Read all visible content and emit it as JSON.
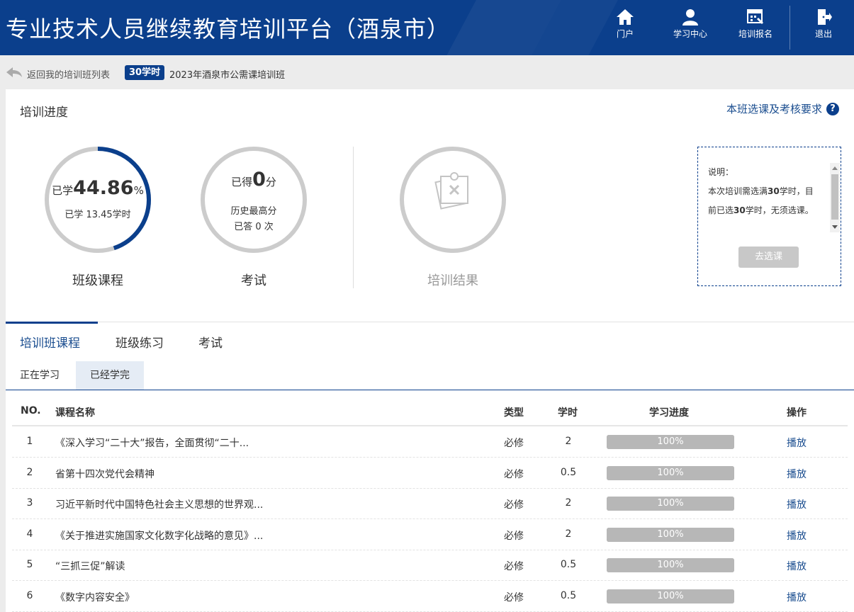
{
  "header": {
    "title": "专业技术人员继续教育培训平台（酒泉市）",
    "nav": [
      {
        "label": "门户",
        "icon": "home-icon"
      },
      {
        "label": "学习中心",
        "icon": "user-icon"
      },
      {
        "label": "培训报名",
        "icon": "register-icon"
      },
      {
        "label": "退出",
        "icon": "logout-icon"
      }
    ]
  },
  "breadcrumb": {
    "back_label": "返回我的培训班列表",
    "hours_badge": "30学时",
    "class_name": "2023年酒泉市公需课培训班"
  },
  "progress": {
    "title": "培训进度",
    "requirements_link": "本班选课及考核要求",
    "help_glyph": "?",
    "course": {
      "prefix": "已学",
      "percent": "44.86",
      "percent_sign": "%",
      "percent_value": 44.86,
      "hours_text": "已学 13.45学时",
      "caption": "班级课程"
    },
    "exam": {
      "prefix": "已得",
      "score": "0",
      "unit": "分",
      "history": "历史最高分",
      "attempts": "已答 0 次",
      "caption": "考试"
    },
    "result": {
      "caption": "培训结果"
    },
    "note": {
      "heading": "说明：",
      "text_a": "本次培训需选满",
      "required": "30",
      "text_b": "学时，目前已选",
      "selected": "30",
      "text_c": "学时，无须选课。",
      "button": "去选课"
    }
  },
  "tabs": [
    "培训班课程",
    "班级练习",
    "考试"
  ],
  "subtabs": [
    "正在学习",
    "已经学完"
  ],
  "table": {
    "headers": [
      "NO.",
      "课程名称",
      "类型",
      "学时",
      "学习进度",
      "操作"
    ],
    "rows": [
      {
        "no": "1",
        "name": "《深入学习“二十大”报告，全面贯彻“二十...",
        "type": "必修",
        "hours": "2",
        "progress": "100%",
        "progress_value": 100,
        "action": "播放"
      },
      {
        "no": "2",
        "name": "省第十四次党代会精神",
        "type": "必修",
        "hours": "0.5",
        "progress": "100%",
        "progress_value": 100,
        "action": "播放"
      },
      {
        "no": "3",
        "name": "习近平新时代中国特色社会主义思想的世界观...",
        "type": "必修",
        "hours": "2",
        "progress": "100%",
        "progress_value": 100,
        "action": "播放"
      },
      {
        "no": "4",
        "name": "《关于推进实施国家文化数字化战略的意见》...",
        "type": "必修",
        "hours": "2",
        "progress": "100%",
        "progress_value": 100,
        "action": "播放"
      },
      {
        "no": "5",
        "name": "“三抓三促”解读",
        "type": "必修",
        "hours": "0.5",
        "progress": "100%",
        "progress_value": 100,
        "action": "播放"
      },
      {
        "no": "6",
        "name": "《数字内容安全》",
        "type": "必修",
        "hours": "0.5",
        "progress": "100%",
        "progress_value": 100,
        "action": "播放"
      }
    ]
  },
  "colors": {
    "brand": "#0b3f8c",
    "ring_track": "#cccccc",
    "link": "#1a4d8f"
  }
}
